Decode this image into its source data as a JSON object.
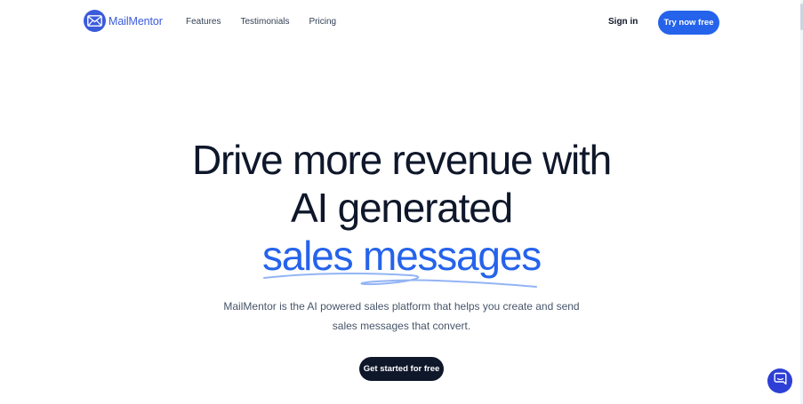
{
  "header": {
    "logo": {
      "icon": "envelope-icon",
      "text": "MailMentor"
    },
    "nav": [
      "Features",
      "Testimonials",
      "Pricing"
    ],
    "sign_in": "Sign in",
    "cta": "Try now free"
  },
  "hero": {
    "title_line1": "Drive more revenue with",
    "title_line2": "AI generated",
    "title_accent": "sales messages",
    "subtitle_line1": "MailMentor is the AI powered sales platform that helps you create and send",
    "subtitle_line2": "sales messages that convert.",
    "cta": "Get started for free"
  },
  "chat_widget": {
    "icon": "chat-bubble-icon"
  },
  "colors": {
    "brand": "#3b5bdb",
    "accent": "#2563eb",
    "dark": "#0f172a",
    "chat": "#2d3fd6"
  }
}
